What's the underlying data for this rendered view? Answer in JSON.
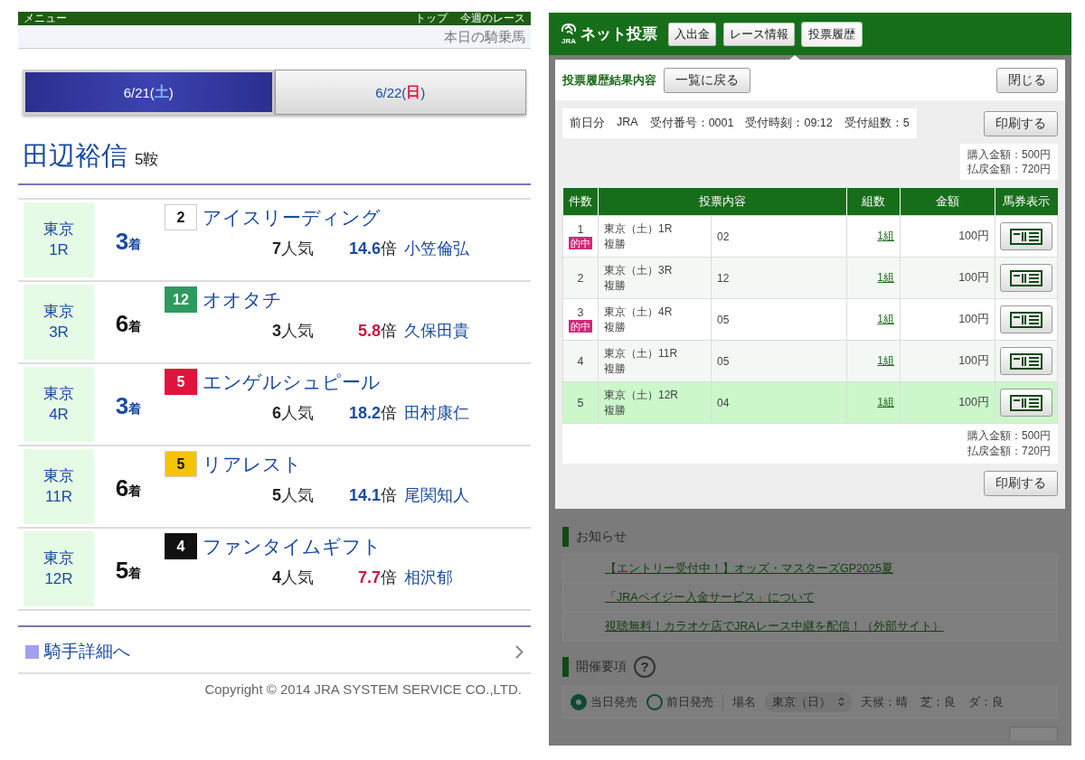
{
  "left": {
    "top_bar": {
      "menu": "メニュー",
      "links": [
        "トップ",
        "今週のレース"
      ]
    },
    "page_title": "本日の騎乗馬",
    "day_tabs": [
      {
        "before": "6/21(",
        "weekday": "土",
        "color": "#8ab4ff",
        "after": ")",
        "selected": true
      },
      {
        "before": "6/22(",
        "weekday": "日",
        "color": "#e0143c",
        "after": ")",
        "selected": false
      }
    ],
    "jockey": {
      "name": "田辺裕信",
      "mounts": "5鞍"
    },
    "rides": [
      {
        "venue": "東京",
        "race": "1R",
        "place_number": "3",
        "place_unit": "着",
        "in_the_money": true,
        "gate": {
          "number": "2",
          "color": "#ffffff"
        },
        "horse": "アイスリーディング",
        "popularity_number": "7",
        "popularity_unit": "人気",
        "odds": "14.6",
        "odds_unit": "倍",
        "low_odds": false,
        "rider": "小笠倫弘"
      },
      {
        "venue": "東京",
        "race": "3R",
        "place_number": "6",
        "place_unit": "着",
        "in_the_money": false,
        "gate": {
          "number": "12",
          "color": "#2e9a5e"
        },
        "horse": "オオタチ",
        "popularity_number": "3",
        "popularity_unit": "人気",
        "odds": "5.8",
        "odds_unit": "倍",
        "low_odds": true,
        "rider": "久保田貴"
      },
      {
        "venue": "東京",
        "race": "4R",
        "place_number": "3",
        "place_unit": "着",
        "in_the_money": true,
        "gate": {
          "number": "5",
          "color": "#e0143c"
        },
        "horse": "エンゲルシュピール",
        "popularity_number": "6",
        "popularity_unit": "人気",
        "odds": "18.2",
        "odds_unit": "倍",
        "low_odds": false,
        "rider": "田村康仁"
      },
      {
        "venue": "東京",
        "race": "11R",
        "place_number": "6",
        "place_unit": "着",
        "in_the_money": false,
        "gate": {
          "number": "5",
          "color": "#f5c400"
        },
        "horse": "リアレスト",
        "popularity_number": "5",
        "popularity_unit": "人気",
        "odds": "14.1",
        "odds_unit": "倍",
        "low_odds": false,
        "rider": "尾関知人"
      },
      {
        "venue": "東京",
        "race": "12R",
        "place_number": "5",
        "place_unit": "着",
        "in_the_money": false,
        "gate": {
          "number": "4",
          "color": "#111111"
        },
        "horse": "ファンタイムギフト",
        "popularity_number": "4",
        "popularity_unit": "人気",
        "odds": "7.7",
        "odds_unit": "倍",
        "low_odds": true,
        "rider": "相沢郁"
      }
    ],
    "detail_link": "騎手詳細へ",
    "copyright": "Copyright © 2014 JRA SYSTEM SERVICE CO.,LTD."
  },
  "right": {
    "header": {
      "logo_label": "JRA",
      "title": "ネット投票",
      "tabs": [
        {
          "label": "入出金",
          "selected": false
        },
        {
          "label": "レース情報",
          "selected": false
        },
        {
          "label": "投票履歴",
          "selected": true
        }
      ]
    },
    "modal": {
      "title": "投票履歴結果内容",
      "back_button": "一覧に戻る",
      "close_button": "閉じる",
      "receipt": [
        "前日分",
        "JRA",
        "受付番号：0001",
        "受付時刻：09:12",
        "受付組数：5"
      ],
      "print_button": "印刷する",
      "totals": [
        "購入金額：500円",
        "払戻金額：720円"
      ],
      "table": {
        "columns": [
          "件数",
          "投票内容",
          "組数",
          "金額",
          "馬券表示"
        ],
        "rows": [
          {
            "no": "1",
            "badge": "的中",
            "race": "東京（土）1R",
            "bet_type": "複勝",
            "selection": "02",
            "combos": "1組",
            "amount": "100円",
            "selected": false
          },
          {
            "no": "2",
            "race": "東京（土）3R",
            "bet_type": "複勝",
            "selection": "12",
            "combos": "1組",
            "amount": "100円",
            "selected": false
          },
          {
            "no": "3",
            "badge": "的中",
            "race": "東京（土）4R",
            "bet_type": "複勝",
            "selection": "05",
            "combos": "1組",
            "amount": "100円",
            "selected": false
          },
          {
            "no": "4",
            "race": "東京（土）11R",
            "bet_type": "複勝",
            "selection": "05",
            "combos": "1組",
            "amount": "100円",
            "selected": false
          },
          {
            "no": "5",
            "race": "東京（土）12R",
            "bet_type": "複勝",
            "selection": "04",
            "combos": "1組",
            "amount": "100円",
            "selected": true
          }
        ]
      },
      "footer_totals": [
        "購入金額：500円",
        "払戻金額：720円"
      ],
      "footer_print_button": "印刷する"
    },
    "notices": {
      "title": "お知らせ",
      "items": [
        "【エントリー受付中！】オッズ・マスターズGP2025夏",
        "「JRAペイジー入金サービス」について",
        "視聴無料！カラオケ店でJRAレース中継を配信！（外部サイト）"
      ]
    },
    "meeting": {
      "title": "開催要項",
      "help": "?",
      "sale_options": [
        {
          "label": "当日発売",
          "selected": true
        },
        {
          "label": "前日発売",
          "selected": false
        }
      ],
      "venue_label": "場名",
      "venue_select": "東京（日）",
      "conditions": [
        "天候：晴",
        "芝：良",
        "ダ：良"
      ]
    }
  }
}
